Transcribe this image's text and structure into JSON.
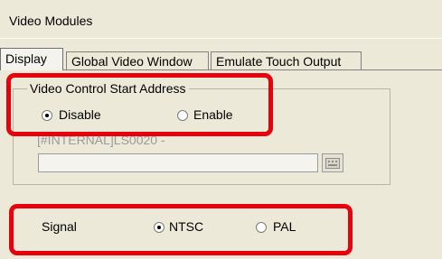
{
  "window": {
    "title": "Video Modules"
  },
  "tabs": [
    {
      "label": "Display",
      "active": true
    },
    {
      "label": "Global Video Window",
      "active": false
    },
    {
      "label": "Emulate Touch Output",
      "active": false
    }
  ],
  "video_control": {
    "group_label": "Video Control Start Address",
    "options": [
      {
        "label": "Disable",
        "checked": true
      },
      {
        "label": "Enable",
        "checked": false
      }
    ],
    "address_label": "[#INTERNAL]LS0020 -",
    "address_value": ""
  },
  "signal": {
    "label": "Signal",
    "options": [
      {
        "label": "NTSC",
        "checked": true
      },
      {
        "label": "PAL",
        "checked": false
      }
    ]
  },
  "colors": {
    "highlight": "#E8000A",
    "dialog_bg": "#ECE9D8"
  }
}
